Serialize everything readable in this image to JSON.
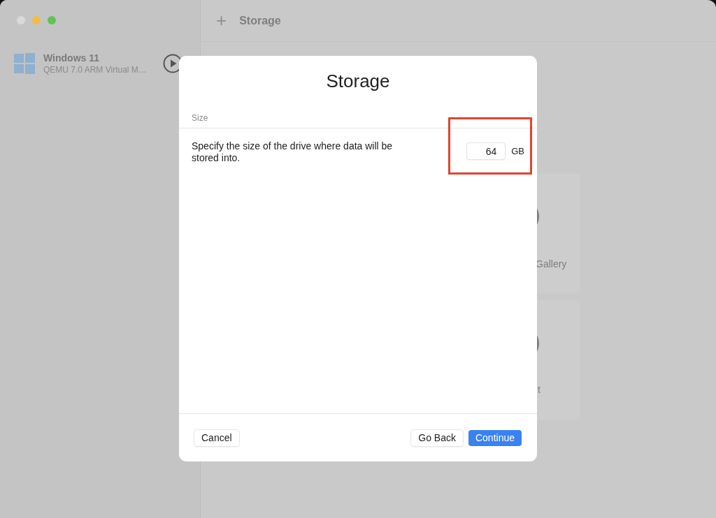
{
  "window": {
    "traffic_lights": [
      {
        "color": "#dadada"
      },
      {
        "color": "#f2bd42"
      },
      {
        "color": "#5fc452"
      }
    ]
  },
  "sidebar": {
    "items": [
      {
        "title": "Windows 11",
        "subtitle": "QEMU 7.0 ARM Virtual M…",
        "selected": false
      }
    ]
  },
  "toolbar": {
    "add": "+",
    "title": "Storage"
  },
  "cards": [
    {
      "label": "Gallery"
    },
    {
      "label": "t"
    }
  ],
  "dialog": {
    "title": "Storage",
    "section": "Size",
    "description": "Specify the size of the drive where data will be stored into.",
    "size": {
      "value": "64",
      "unit": "GB",
      "highlighted": true
    },
    "buttons": [
      {
        "label": "Cancel",
        "kind": "secondary"
      },
      {
        "label": "Go Back",
        "kind": "secondary"
      },
      {
        "label": "Continue",
        "kind": "primary"
      }
    ]
  }
}
